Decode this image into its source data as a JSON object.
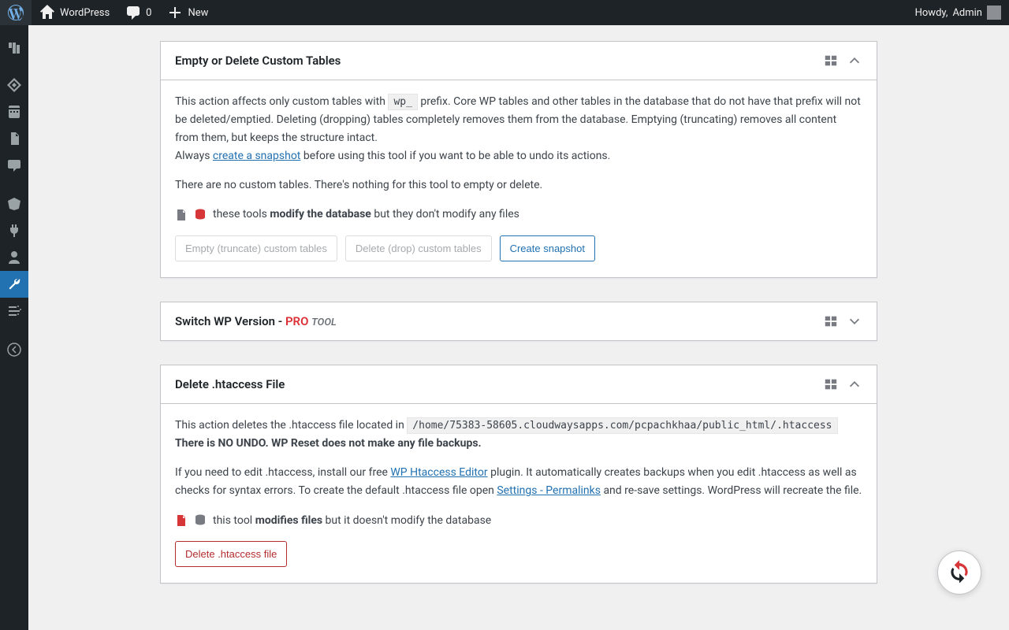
{
  "adminbar": {
    "site_name": "WordPress",
    "comment_count": "0",
    "new_label": "New",
    "howdy_prefix": "Howdy, ",
    "user_name": "Admin"
  },
  "sidemenu": {
    "items": [
      {
        "name": "dashboard"
      },
      {
        "name": "posts"
      },
      {
        "name": "media"
      },
      {
        "name": "pages"
      },
      {
        "name": "comments"
      },
      {
        "name": "appearance"
      },
      {
        "name": "plugins"
      },
      {
        "name": "users"
      },
      {
        "name": "tools"
      },
      {
        "name": "settings"
      },
      {
        "name": "collapse"
      }
    ],
    "current": "tools"
  },
  "boxes": {
    "empty_delete": {
      "title": "Empty or Delete Custom Tables",
      "desc_before_prefix": "This action affects only custom tables with ",
      "prefix_code": "wp_",
      "desc_after_prefix": " prefix. Core WP tables and other tables in the database that do not have that prefix will not be deleted/emptied. Deleting (dropping) tables completely removes them from the database. Emptying (truncating) removes all content from them, but keeps the structure intact.",
      "l2_before": "Always ",
      "snapshot_link": "create a snapshot",
      "l2_after": " before using this tool if you want to be able to undo its actions.",
      "none_msg": "There are no custom tables. There's nothing for this tool to empty or delete.",
      "note_before": "these tools ",
      "note_bold": "modify the database",
      "note_after": " but they don't modify any files",
      "buttons": {
        "empty": "Empty (truncate) custom tables",
        "drop": "Delete (drop) custom tables",
        "snapshot": "Create snapshot"
      }
    },
    "switch_wp": {
      "title_base": "Switch WP Version - ",
      "pro": "PRO",
      "tool": "TOOL"
    },
    "htaccess": {
      "title": "Delete .htaccess File",
      "l1_before": "This action deletes the .htaccess file located in ",
      "path_code": "/home/75383-58605.cloudwaysapps.com/pcpachkhaa/public_html/.htaccess",
      "l1_bold_line": "There is NO UNDO. WP Reset does not make any file backups.",
      "l2_before": "If you need to edit .htaccess, install our free ",
      "editor_link": "WP Htaccess Editor",
      "l2_mid": " plugin. It automatically creates backups when you edit .htaccess as well as checks for syntax errors. To create the default .htaccess file open ",
      "settings_link": "Settings - Permalinks",
      "l2_after": " and re-save settings. WordPress will recreate the file.",
      "note_before": "this tool ",
      "note_bold": "modifies files",
      "note_after": " but it doesn't modify the database",
      "button": "Delete .htaccess file"
    }
  }
}
